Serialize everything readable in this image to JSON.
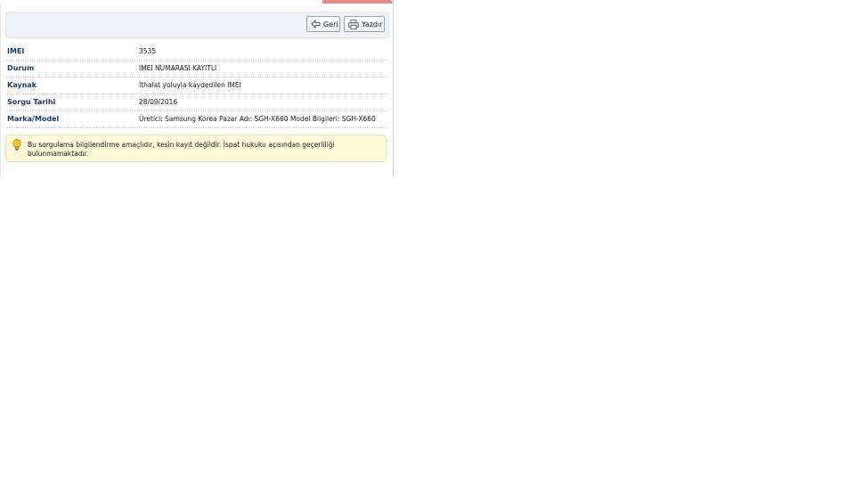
{
  "toolbar": {
    "back_label": "Geri",
    "print_label": "Yazdır"
  },
  "details": {
    "rows": [
      {
        "label": "IMEI",
        "value": "3535"
      },
      {
        "label": "Durum",
        "value": "IMEI NUMARASI KAYITLI"
      },
      {
        "label": "Kaynak",
        "value": "İthalat yoluyla kaydedilen IMEI"
      },
      {
        "label": "Sorgu Tarihi",
        "value": "28/09/2016"
      },
      {
        "label": "Marka/Model",
        "value": "Üretici: Samsung Korea Pazar Adı: SGH-X660 Model Bilgileri: SGH-X660"
      }
    ]
  },
  "notice": {
    "text": "Bu sorgulama bilgilendirme amaçlıdır, kesin kayıt değildir. İspat hukuku açısından geçerliliği bulunmamaktadır.",
    "icon": "lightbulb-icon"
  },
  "colors": {
    "label_text": "#1f3b63",
    "notice_bg": "#fff8d9",
    "toolbar_bg": "#eef2f6"
  }
}
